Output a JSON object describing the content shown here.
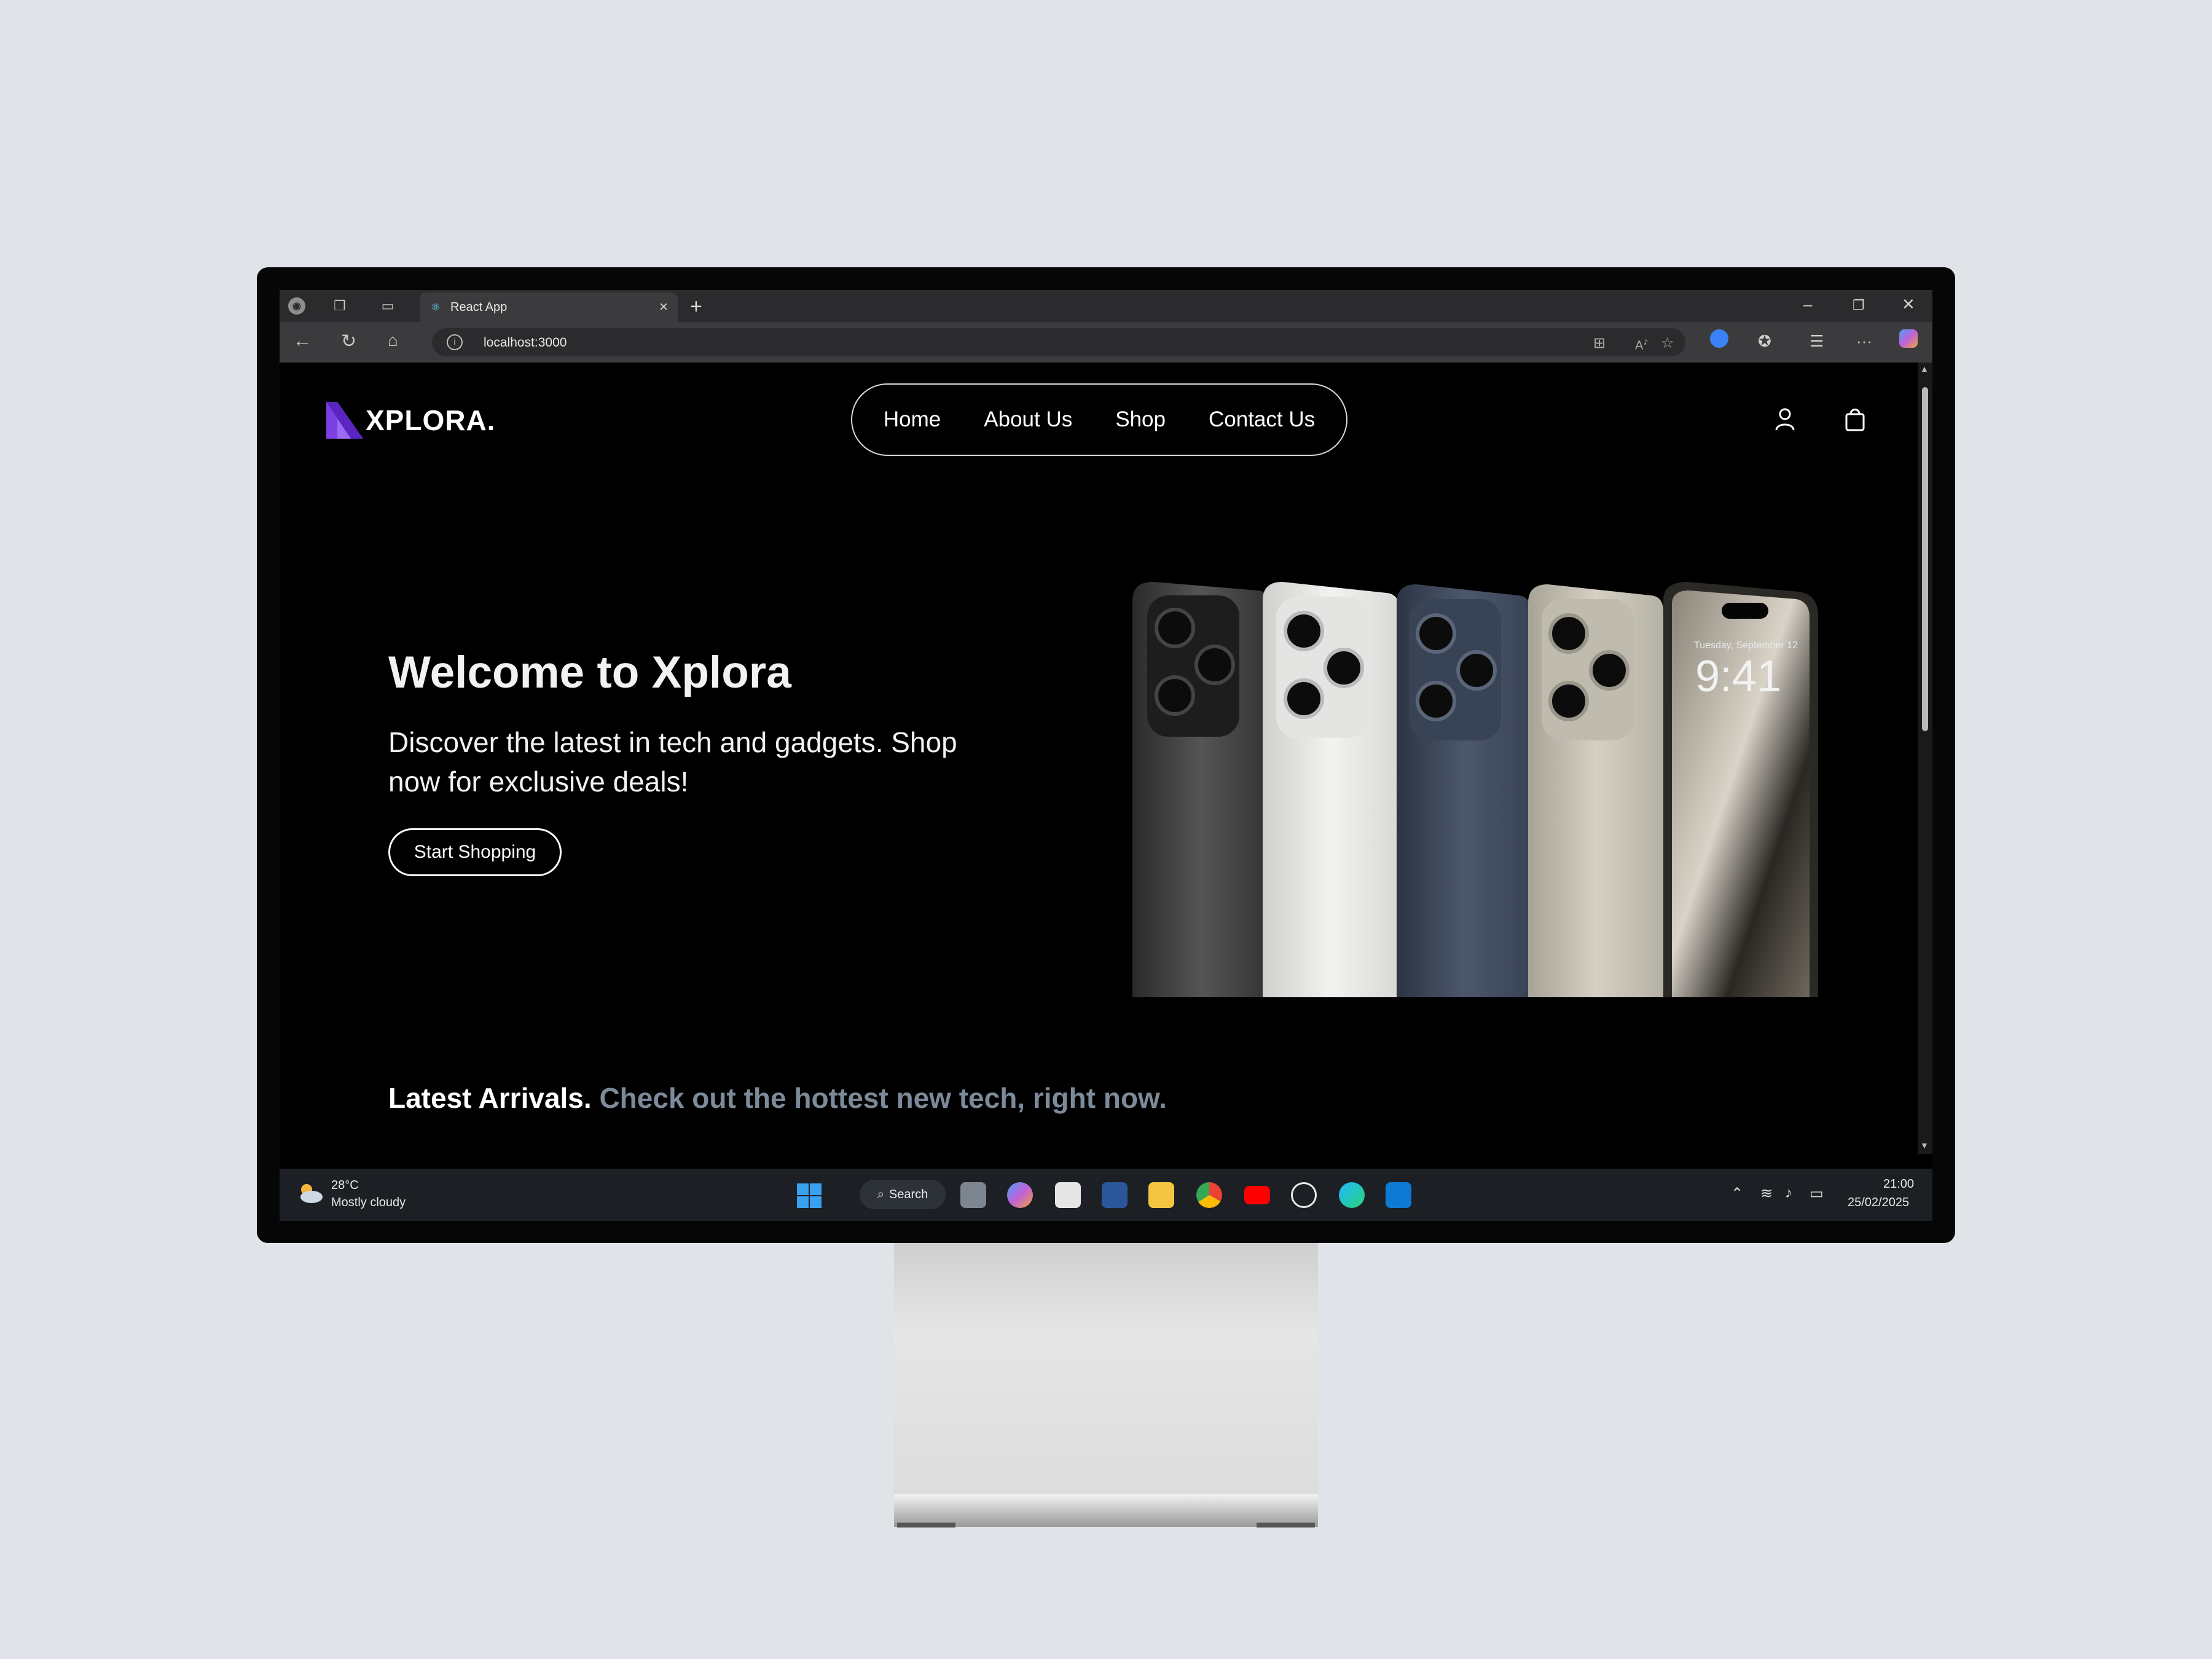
{
  "browser": {
    "tab_title": "React App",
    "url": "localhost:3000"
  },
  "site": {
    "logo_text": "XPLORA.",
    "nav": [
      "Home",
      "About Us",
      "Shop",
      "Contact Us"
    ],
    "hero": {
      "title": "Welcome to Xplora",
      "description": "Discover the latest in tech and gadgets. Shop now for exclusive deals!",
      "cta": "Start Shopping"
    },
    "latest": {
      "lead": "Latest Arrivals.",
      "tagline": "Check out the hottest new tech, right now."
    },
    "phone_screen_date": "Tuesday, September 12",
    "phone_screen_time": "9:41"
  },
  "taskbar": {
    "weather_temp": "28°C",
    "weather_desc": "Mostly cloudy",
    "search_label": "Search",
    "time": "21:00",
    "date": "25/02/2025"
  },
  "colors": {
    "accent_logo": "#7b3fe4",
    "tagline_gray": "#7c8a99",
    "page_bg": "#000000",
    "backdrop": "#e0e3e7"
  }
}
